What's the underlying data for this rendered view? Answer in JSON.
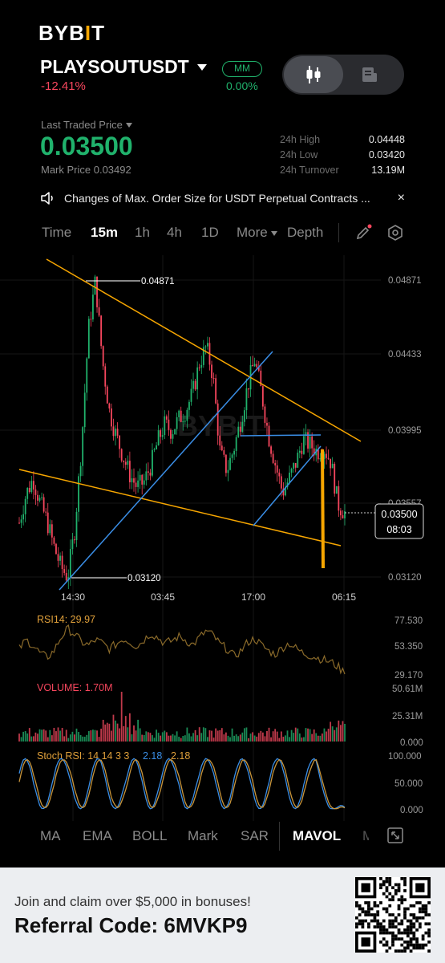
{
  "brand": {
    "name": "BYBIT"
  },
  "header": {
    "pair": "PLAYSOUTUSDT",
    "change": "-12.41%",
    "mm_badge": "MM",
    "mm_value": "0.00%"
  },
  "ticker": {
    "last_price_label": "Last Traded Price",
    "last_price": "0.03500",
    "mark_price": "Mark Price 0.03492",
    "stats": [
      {
        "label": "24h High",
        "value": "0.04448"
      },
      {
        "label": "24h Low",
        "value": "0.03420"
      },
      {
        "label": "24h Turnover",
        "value": "13.19M"
      }
    ]
  },
  "notice": {
    "text": "Changes of Max. Order Size for USDT Perpetual Contracts ...",
    "close": "×"
  },
  "timeframes": [
    "Time",
    "15m",
    "1h",
    "4h",
    "1D",
    "More",
    "Depth"
  ],
  "active_timeframe": "15m",
  "chart_data": [
    {
      "type": "candlestick",
      "title": "PLAYSOUTUSDT 15m",
      "x_ticks": [
        "14:30",
        "03:45",
        "17:00",
        "06:15"
      ],
      "y_ticks": [
        "0.04871",
        "0.04433",
        "0.03995",
        "0.03557",
        "0.03120"
      ],
      "ylim": [
        0.0312,
        0.04871
      ],
      "annotations": {
        "high": "0.04871",
        "low": "0.03120"
      },
      "current_price": "0.03500",
      "countdown": "08:03",
      "approx_close_path": [
        0.0344,
        0.0361,
        0.037,
        0.0356,
        0.0345,
        0.033,
        0.0318,
        0.0312,
        0.034,
        0.039,
        0.0458,
        0.0487,
        0.044,
        0.041,
        0.0395,
        0.0383,
        0.0372,
        0.0365,
        0.0368,
        0.0378,
        0.0392,
        0.0402,
        0.0398,
        0.0405,
        0.041,
        0.042,
        0.0438,
        0.0448,
        0.043,
        0.0385,
        0.0375,
        0.0388,
        0.0405,
        0.0425,
        0.044,
        0.042,
        0.0395,
        0.0378,
        0.0362,
        0.037,
        0.038,
        0.0393,
        0.039,
        0.0386,
        0.0388,
        0.038,
        0.0355,
        0.035
      ],
      "colors": {
        "up": "#20b26c",
        "down": "#f6465d"
      }
    },
    {
      "type": "line",
      "title": "RSI14: 29.97",
      "y_ticks": [
        "77.530",
        "53.350",
        "29.170"
      ],
      "ylim": [
        29.17,
        77.53
      ],
      "values": [
        52,
        60,
        55,
        48,
        44,
        50,
        62,
        70,
        65,
        58,
        55,
        60,
        57,
        52,
        56,
        61,
        58,
        54,
        60,
        66,
        62,
        57,
        59,
        63,
        60,
        55,
        62,
        68,
        64,
        56,
        52,
        45,
        50,
        58,
        61,
        55,
        50,
        47,
        53,
        57,
        52,
        48,
        46,
        44,
        42,
        40,
        36,
        30
      ],
      "color": "#c9953a"
    },
    {
      "type": "bar",
      "title": "VOLUME: 1.70M",
      "y_ticks": [
        "50.61M",
        "25.31M",
        "0.000"
      ],
      "ylim": [
        0,
        50.61
      ]
    },
    {
      "type": "line",
      "title": "Stoch RSI: 14 14 3 3",
      "legend": [
        "2.18",
        "2.18"
      ],
      "y_ticks": [
        "100.000",
        "50.000",
        "0.000"
      ],
      "ylim": [
        0,
        100
      ]
    }
  ],
  "indicator_tabs": [
    "MA",
    "EMA",
    "BOLL",
    "Mark",
    "SAR",
    "MAVOL"
  ],
  "active_indicator": "MAVOL",
  "footer": {
    "sub": "Join and claim over $5,000 in bonuses!",
    "code": "Referral Code: 6MVKP9"
  }
}
